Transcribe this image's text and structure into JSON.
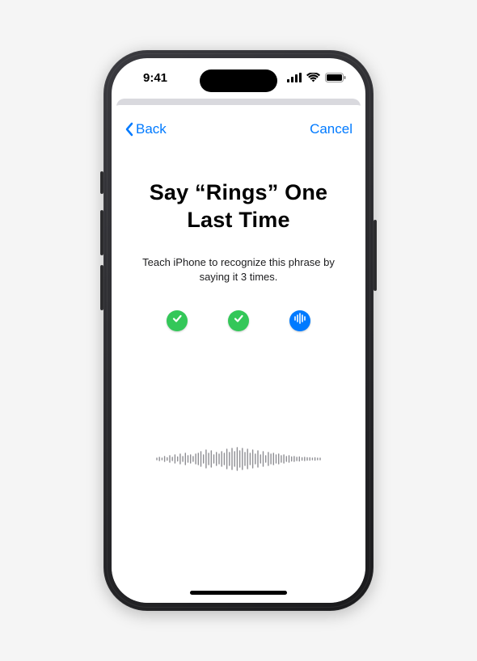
{
  "status": {
    "time": "9:41"
  },
  "nav": {
    "back_label": "Back",
    "cancel_label": "Cancel"
  },
  "main": {
    "title": "Say “Rings” One Last Time",
    "subtitle": "Teach iPhone to recognize this phrase by saying it 3 times.",
    "attempts": [
      {
        "state": "done"
      },
      {
        "state": "done"
      },
      {
        "state": "active"
      }
    ]
  },
  "colors": {
    "accent": "#007aff",
    "success": "#34c759"
  }
}
